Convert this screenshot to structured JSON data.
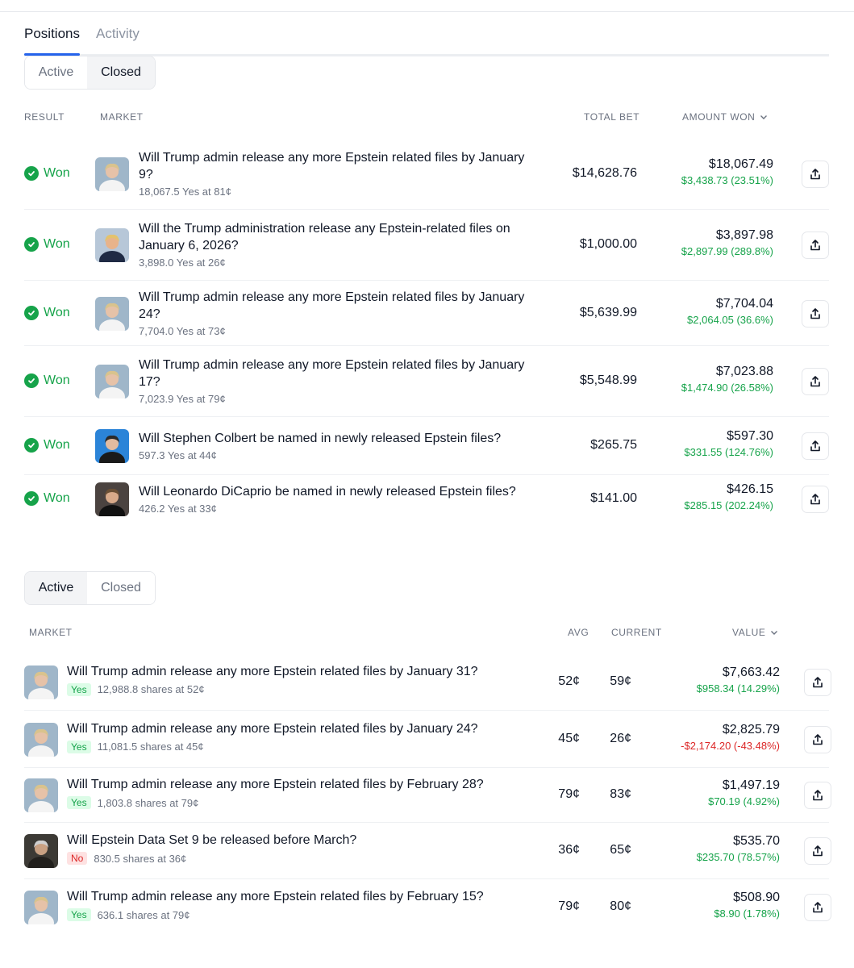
{
  "tabs": [
    {
      "label": "Positions",
      "active": true
    },
    {
      "label": "Activity",
      "active": false
    }
  ],
  "closed_section": {
    "toggle": [
      "Active",
      "Closed"
    ],
    "selected": "Closed",
    "headers": {
      "result": "RESULT",
      "market": "MARKET",
      "total_bet": "TOTAL BET",
      "amount_won": "AMOUNT WON"
    },
    "rows": [
      {
        "result": "Won",
        "title_lines": [
          "Will Trump admin release any more Epstein related files by January",
          "9?"
        ],
        "sub": "18,067.5 Yes at 81¢",
        "total_bet": "$14,628.76",
        "amount": "$18,067.49",
        "delta": "$3,438.73 (23.51%)",
        "thumb": "portrait-1"
      },
      {
        "result": "Won",
        "title_lines": [
          "Will the Trump administration release any Epstein-related files on",
          "January 6, 2026?"
        ],
        "sub": "3,898.0 Yes at 26¢",
        "total_bet": "$1,000.00",
        "amount": "$3,897.98",
        "delta": "$2,897.99 (289.8%)",
        "thumb": "portrait-2"
      },
      {
        "result": "Won",
        "title_lines": [
          "Will Trump admin release any more Epstein related files by January",
          "24?"
        ],
        "sub": "7,704.0 Yes at 73¢",
        "total_bet": "$5,639.99",
        "amount": "$7,704.04",
        "delta": "$2,064.05 (36.6%)",
        "thumb": "portrait-1"
      },
      {
        "result": "Won",
        "title_lines": [
          "Will Trump admin release any more Epstein related files by January",
          "17?"
        ],
        "sub": "7,023.9 Yes at 79¢",
        "total_bet": "$5,548.99",
        "amount": "$7,023.88",
        "delta": "$1,474.90 (26.58%)",
        "thumb": "portrait-1"
      },
      {
        "result": "Won",
        "title_lines": [
          "Will Stephen Colbert be named in newly released Epstein files?"
        ],
        "sub": "597.3 Yes at 44¢",
        "total_bet": "$265.75",
        "amount": "$597.30",
        "delta": "$331.55 (124.76%)",
        "thumb": "portrait-3"
      },
      {
        "result": "Won",
        "title_lines": [
          "Will Leonardo DiCaprio be named in newly released Epstein files?"
        ],
        "sub": "426.2 Yes at 33¢",
        "total_bet": "$141.00",
        "amount": "$426.15",
        "delta": "$285.15 (202.24%)",
        "thumb": "portrait-4"
      }
    ]
  },
  "active_section": {
    "toggle": [
      "Active",
      "Closed"
    ],
    "selected": "Active",
    "headers": {
      "market": "MARKET",
      "avg": "AVG",
      "current": "CURRENT",
      "value": "VALUE"
    },
    "rows": [
      {
        "title": "Will Trump admin release any more Epstein related files by January 31?",
        "outcome": "Yes",
        "sub": "12,988.8 shares at 52¢",
        "avg": "52¢",
        "current": "59¢",
        "value": "$7,663.42",
        "delta": "$958.34 (14.29%)",
        "direction": "up",
        "thumb": "portrait-1"
      },
      {
        "title": "Will Trump admin release any more Epstein related files by January 24?",
        "outcome": "Yes",
        "sub": "11,081.5 shares at 45¢",
        "avg": "45¢",
        "current": "26¢",
        "value": "$2,825.79",
        "delta": "-$2,174.20 (-43.48%)",
        "direction": "down",
        "thumb": "portrait-1"
      },
      {
        "title": "Will Trump admin release any more Epstein related files by February 28?",
        "outcome": "Yes",
        "sub": "1,803.8 shares at 79¢",
        "avg": "79¢",
        "current": "83¢",
        "value": "$1,497.19",
        "delta": "$70.19 (4.92%)",
        "direction": "up",
        "thumb": "portrait-1"
      },
      {
        "title": "Will Epstein Data Set 9 be released before March?",
        "outcome": "No",
        "sub": "830.5 shares at 36¢",
        "avg": "36¢",
        "current": "65¢",
        "value": "$535.70",
        "delta": "$235.70 (78.57%)",
        "direction": "up",
        "thumb": "portrait-5"
      },
      {
        "title": "Will Trump admin release any more Epstein related files by February 15?",
        "outcome": "Yes",
        "sub": "636.1 shares at 79¢",
        "avg": "79¢",
        "current": "80¢",
        "value": "$508.90",
        "delta": "$8.90 (1.78%)",
        "direction": "up",
        "thumb": "portrait-1"
      }
    ]
  },
  "colors": {
    "accent": "#2563eb",
    "positive": "#16a34a",
    "negative": "#dc2626",
    "muted": "#6b7280"
  }
}
